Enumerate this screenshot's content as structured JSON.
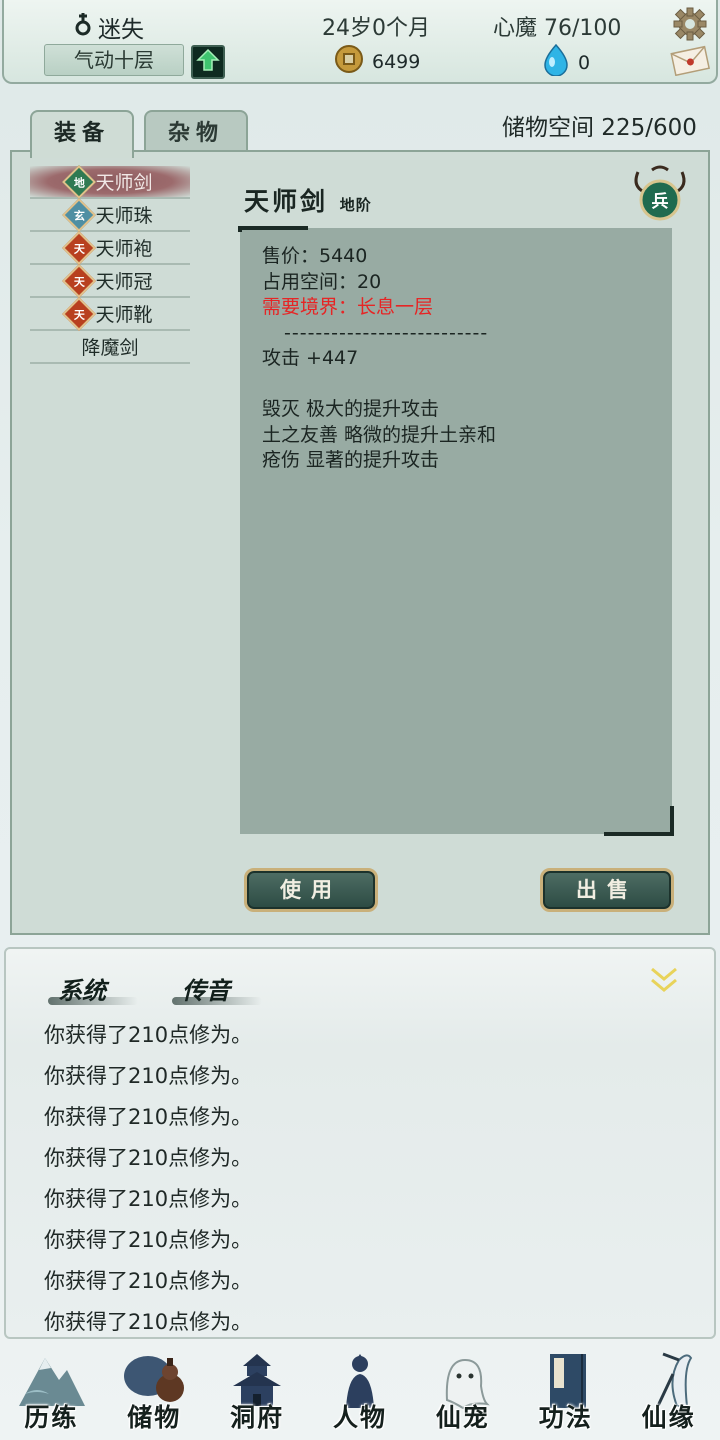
{
  "status_bar": {
    "character_name": "迷失",
    "realm": "气动十层",
    "age": "24岁0个月",
    "heart_demon": "心魔  76/100",
    "coins": "6499",
    "spirit_stones": "0"
  },
  "inventory": {
    "tabs": [
      {
        "label": "装备"
      },
      {
        "label": "杂物"
      }
    ],
    "storage_label": "储物空间  225/600",
    "items": [
      {
        "name": "天师剑",
        "badge": "地",
        "selected": true
      },
      {
        "name": "天师珠",
        "badge": "玄"
      },
      {
        "name": "天师袍",
        "badge": "天"
      },
      {
        "name": "天师冠",
        "badge": "天"
      },
      {
        "name": "天师靴",
        "badge": "天"
      },
      {
        "name": "降魔剑"
      }
    ],
    "detail": {
      "name": "天师剑",
      "grade": "地阶",
      "type_badge": "兵",
      "price": "售价：5440",
      "space": "占用空间：20",
      "requirement": "需要境界：长息一层",
      "separator": "--------------------------",
      "attack": "攻击 +447",
      "effects": [
        "毁灭 极大的提升攻击",
        "土之友善 略微的提升土亲和",
        "疮伤 显著的提升攻击"
      ]
    },
    "use_button": "使用",
    "sell_button": "出售"
  },
  "log": {
    "tabs": [
      "系统",
      "传音"
    ],
    "messages": [
      "你获得了210点修为。",
      "你获得了210点修为。",
      "你获得了210点修为。",
      "你获得了210点修为。",
      "你获得了210点修为。",
      "你获得了210点修为。",
      "你获得了210点修为。",
      "你获得了210点修为。"
    ]
  },
  "bottom_nav": [
    {
      "label": "历练",
      "icon": "mountain-icon"
    },
    {
      "label": "储物",
      "icon": "gourd-icon"
    },
    {
      "label": "洞府",
      "icon": "pagoda-icon"
    },
    {
      "label": "人物",
      "icon": "figure-icon"
    },
    {
      "label": "仙宠",
      "icon": "spirit-pet-icon"
    },
    {
      "label": "功法",
      "icon": "scripture-book-icon"
    },
    {
      "label": "仙缘",
      "icon": "crane-icon"
    }
  ],
  "colors": {
    "requirement_red": "#e62525",
    "panel_bg": "#cfdcd6",
    "detail_bg": "#98aba3",
    "button_gold": "#c9b07a"
  }
}
